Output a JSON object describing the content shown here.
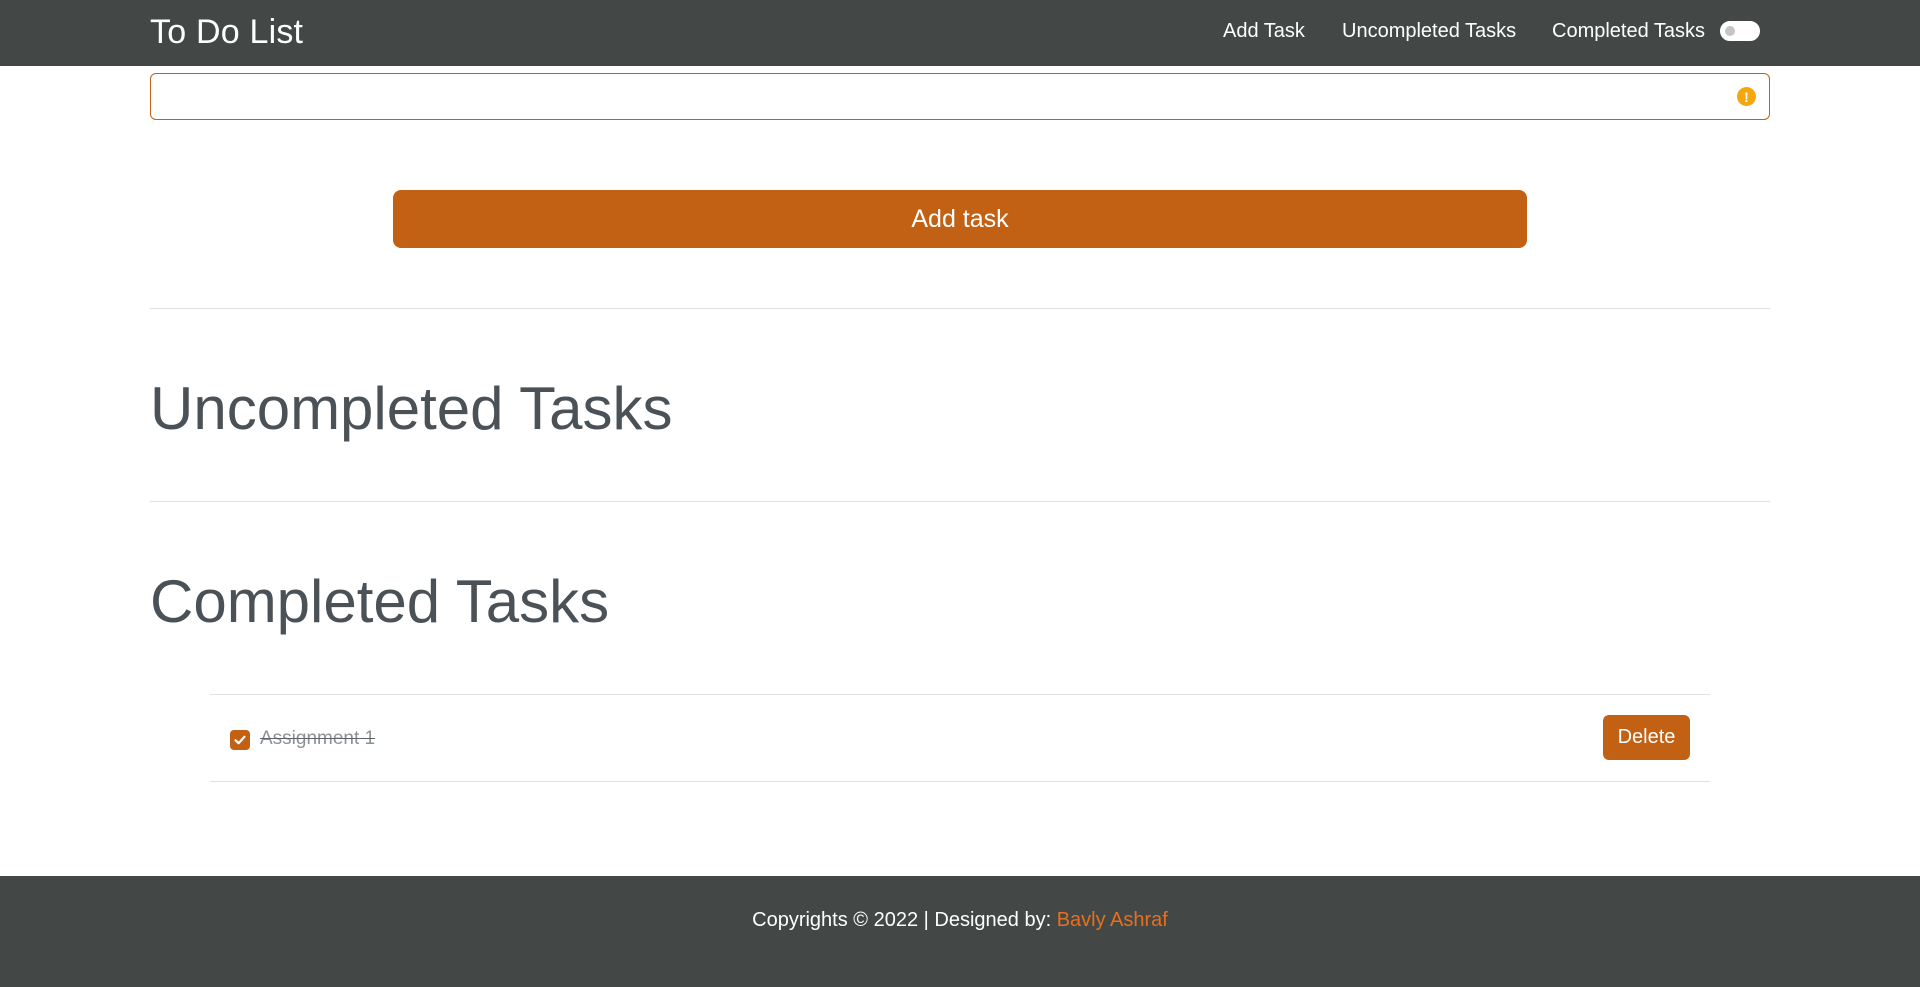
{
  "navbar": {
    "brand": "To Do List",
    "links": [
      "Add Task",
      "Uncompleted Tasks",
      "Completed Tasks"
    ],
    "toggle_checked": false
  },
  "form": {
    "input_value": "",
    "warning_icon": "exclamation-circle-icon",
    "add_button_label": "Add task"
  },
  "sections": {
    "uncompleted_title": "Uncompleted Tasks",
    "completed_title": "Completed Tasks"
  },
  "completed_tasks": [
    {
      "text": "Assignment 1",
      "done": true,
      "delete_label": "Delete"
    }
  ],
  "footer": {
    "text": "Copyrights © 2022 | Designed by: ",
    "author": "Bavly Ashraf"
  },
  "colors": {
    "accent": "#c26114",
    "navbar_bg": "#434745",
    "footer_link": "#e86f1e",
    "warning": "#f4a70f"
  }
}
